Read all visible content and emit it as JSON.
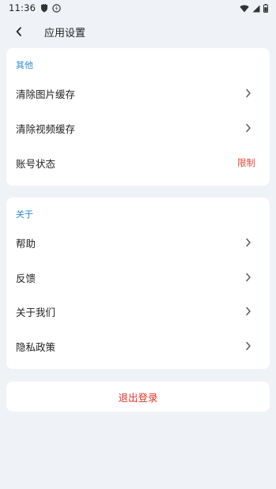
{
  "status_bar": {
    "time": "11:36",
    "icons": [
      "shield-icon",
      "sync-icon",
      "wifi-icon",
      "signal-icon",
      "battery-icon"
    ]
  },
  "header": {
    "back_icon": "chevron-left-icon",
    "title": "应用设置"
  },
  "sections": [
    {
      "title": "其他",
      "items": [
        {
          "label": "清除图片缓存",
          "icon": "chevron-right-icon"
        },
        {
          "label": "清除视频缓存",
          "icon": "chevron-right-icon"
        },
        {
          "label": "账号状态",
          "value": "限制"
        }
      ]
    },
    {
      "title": "关于",
      "items": [
        {
          "label": "帮助",
          "icon": "chevron-right-icon"
        },
        {
          "label": "反馈",
          "icon": "chevron-right-icon"
        },
        {
          "label": "关于我们",
          "icon": "chevron-right-icon"
        },
        {
          "label": "隐私政策",
          "icon": "chevron-right-icon"
        }
      ]
    }
  ],
  "logout": {
    "label": "退出登录"
  },
  "colors": {
    "background": "#eff2f7",
    "card": "#ffffff",
    "section_title": "#2a8bd4",
    "warning": "#e04b3a",
    "logout": "#e0342a"
  }
}
